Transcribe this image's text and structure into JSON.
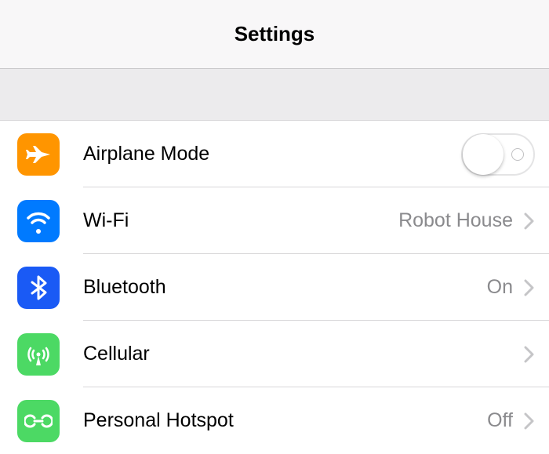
{
  "header": {
    "title": "Settings"
  },
  "rows": {
    "airplane": {
      "label": "Airplane Mode",
      "toggle": false
    },
    "wifi": {
      "label": "Wi-Fi",
      "value": "Robot House"
    },
    "bluetooth": {
      "label": "Bluetooth",
      "value": "On"
    },
    "cellular": {
      "label": "Cellular",
      "value": ""
    },
    "hotspot": {
      "label": "Personal Hotspot",
      "value": "Off"
    }
  },
  "colors": {
    "orange": "#ff9500",
    "blue1": "#007aff",
    "blue2": "#1a5af5",
    "green": "#4cd964"
  }
}
